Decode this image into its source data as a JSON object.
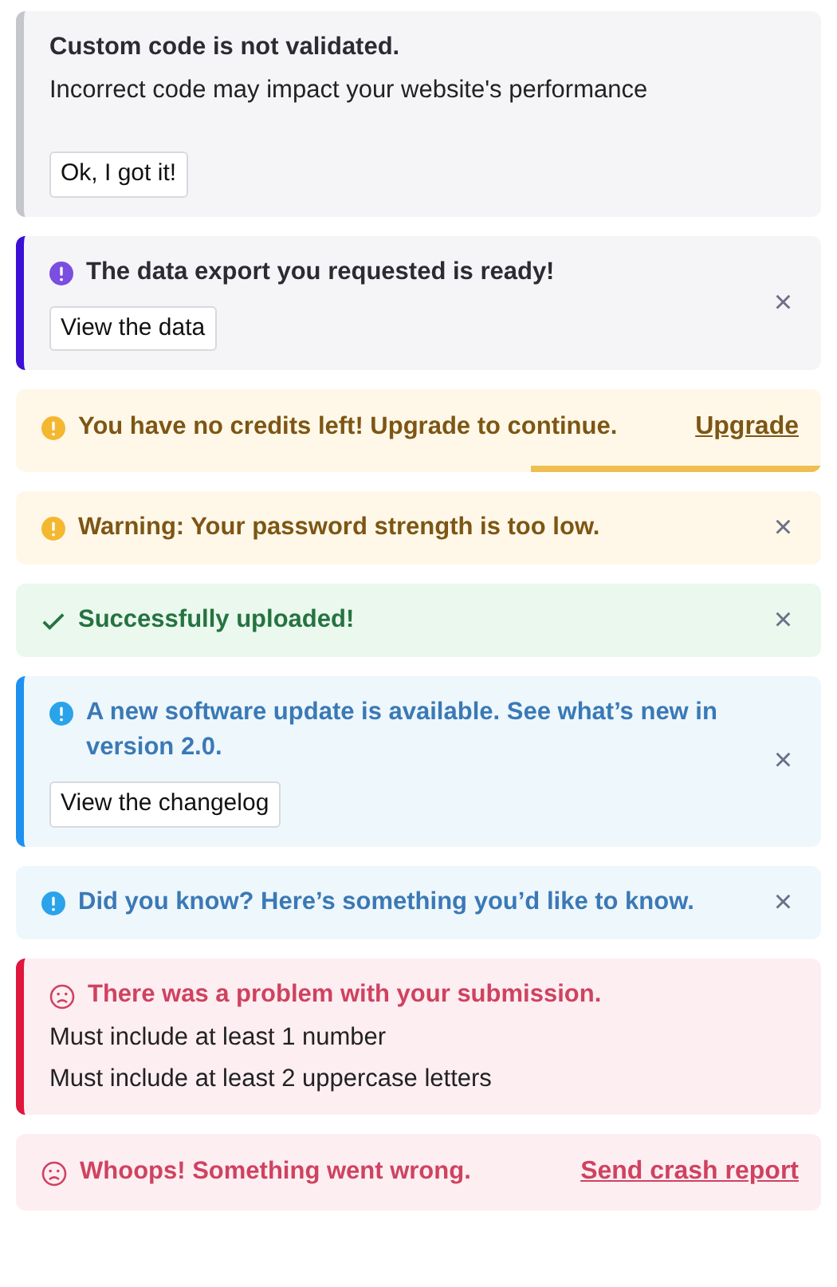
{
  "alerts": [
    {
      "kind": "neutral",
      "accent": true,
      "title": "Custom code is not validated.",
      "lines": [
        "Incorrect code may impact your website's performance"
      ],
      "button": "Ok, I got it!"
    },
    {
      "kind": "purple",
      "accent": true,
      "title": "The data export you requested is ready!",
      "button": "View the data",
      "close": "×"
    },
    {
      "kind": "warning",
      "accent": false,
      "title": "You have no credits left! Upgrade to continue.",
      "link": "Upgrade",
      "level": 0.36
    },
    {
      "kind": "warning",
      "accent": false,
      "title": "Warning: Your password strength is too low.",
      "close": "×"
    },
    {
      "kind": "success",
      "accent": false,
      "title": "Successfully uploaded!",
      "close": "×"
    },
    {
      "kind": "info",
      "accent": true,
      "title": "A new software update is available. See what’s new in version 2.0.",
      "button": "View the changelog",
      "close": "×"
    },
    {
      "kind": "info",
      "accent": false,
      "title": "Did you know? Here’s something you’d like to know.",
      "close": "×"
    },
    {
      "kind": "error",
      "accent": true,
      "title": "There was a problem with your submission.",
      "lines": [
        "Must include at least 1 number",
        "Must include at least 2 uppercase letters"
      ]
    },
    {
      "kind": "error",
      "accent": false,
      "title": "Whoops! Something went wrong.",
      "link": "Send crash report"
    }
  ]
}
